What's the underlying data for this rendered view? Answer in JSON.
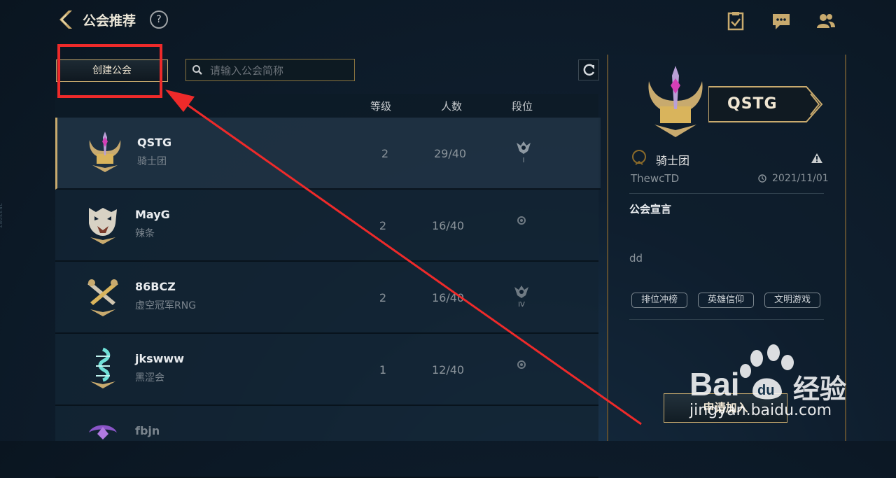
{
  "header": {
    "title": "公会推荐",
    "help": "?"
  },
  "toolbar": {
    "create_label": "创建公会",
    "search_placeholder": "请输入公会简称"
  },
  "list": {
    "columns": [
      "等级",
      "人数",
      "段位"
    ],
    "rows": [
      {
        "name": "QSTG",
        "sub": "骑士团",
        "level": "2",
        "members": "29/40",
        "rank_num": "I",
        "rank_icon": "rank-crest-icon",
        "emblem": "sword-crest-icon"
      },
      {
        "name": "MayG",
        "sub": "辣条",
        "level": "2",
        "members": "16/40",
        "rank_num": "",
        "rank_icon": "rank-unranked-icon",
        "emblem": "beast-crest-icon"
      },
      {
        "name": "86BCZ",
        "sub": "虚空冠军RNG",
        "level": "2",
        "members": "16/40",
        "rank_num": "IV",
        "rank_icon": "rank-crest-icon",
        "emblem": "crossed-guns-icon"
      },
      {
        "name": "jkswww",
        "sub": "黑涩会",
        "level": "1",
        "members": "12/40",
        "rank_num": "",
        "rank_icon": "rank-unranked-icon",
        "emblem": "serpent-crest-icon"
      },
      {
        "name": "fbjn",
        "sub": "",
        "level": "",
        "members": "",
        "rank_num": "",
        "rank_icon": "",
        "emblem": "purple-crest-icon"
      }
    ]
  },
  "detail": {
    "name": "QSTG",
    "rank_text": "骑士团",
    "leader": "ThewcTD",
    "date": "2021/11/01",
    "declaration_title": "公会宣言",
    "declaration": "dd",
    "tags": [
      "排位冲榜",
      "英雄信仰",
      "文明游戏"
    ],
    "join_label": "申请加入"
  },
  "watermark": {
    "brand": "Bai",
    "brand2": "经验",
    "url": "jingyan.baidu.com"
  },
  "side_id": "2533087",
  "colors": {
    "gold": "#c8aa6e",
    "annotation_red": "#ee2a2a"
  }
}
